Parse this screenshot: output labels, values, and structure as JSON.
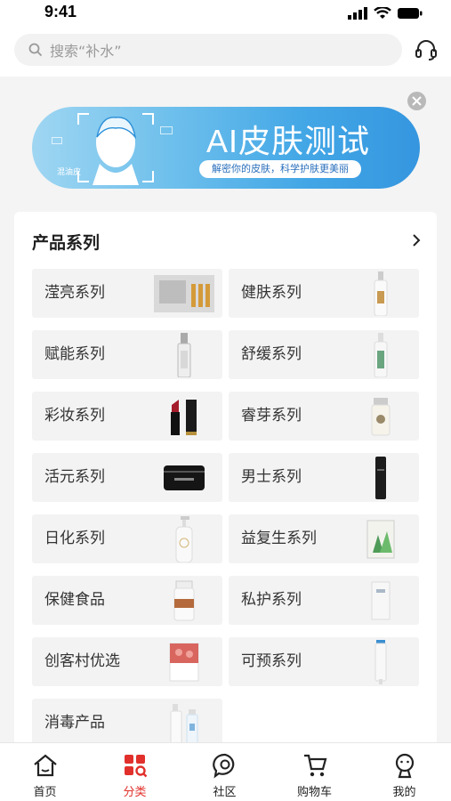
{
  "status": {
    "time": "9:41"
  },
  "search": {
    "placeholder": "搜索“补水”"
  },
  "banner": {
    "title": "AI皮肤测试",
    "subtitle": "解密你的皮肤，科学护肤更美丽",
    "tag": "混油皮"
  },
  "panel": {
    "title": "产品系列",
    "items": [
      {
        "label": "滢亮系列",
        "icon": "ampoule-set-icon"
      },
      {
        "label": "健肤系列",
        "icon": "lotion-bottle-icon"
      },
      {
        "label": "赋能系列",
        "icon": "serum-bottle-icon"
      },
      {
        "label": "舒缓系列",
        "icon": "toner-bottle-icon"
      },
      {
        "label": "彩妆系列",
        "icon": "lipstick-icon"
      },
      {
        "label": "睿芽系列",
        "icon": "cream-jar-icon"
      },
      {
        "label": "活元系列",
        "icon": "black-jar-icon"
      },
      {
        "label": "男士系列",
        "icon": "black-bottle-icon"
      },
      {
        "label": "日化系列",
        "icon": "pump-bottle-icon"
      },
      {
        "label": "益复生系列",
        "icon": "green-box-icon"
      },
      {
        "label": "保健食品",
        "icon": "supplement-bottle-icon"
      },
      {
        "label": "私护系列",
        "icon": "sachet-icon"
      },
      {
        "label": "创客村优选",
        "icon": "food-package-icon"
      },
      {
        "label": "可预系列",
        "icon": "tube-icon"
      },
      {
        "label": "消毒产品",
        "icon": "spray-bottles-icon"
      }
    ]
  },
  "tabs": [
    {
      "label": "首页",
      "icon": "home-icon"
    },
    {
      "label": "分类",
      "icon": "category-icon"
    },
    {
      "label": "社区",
      "icon": "community-icon"
    },
    {
      "label": "购物车",
      "icon": "cart-icon"
    },
    {
      "label": "我的",
      "icon": "profile-icon"
    }
  ],
  "colors": {
    "accent": "#e1302b",
    "banner": "#43a7e6"
  }
}
